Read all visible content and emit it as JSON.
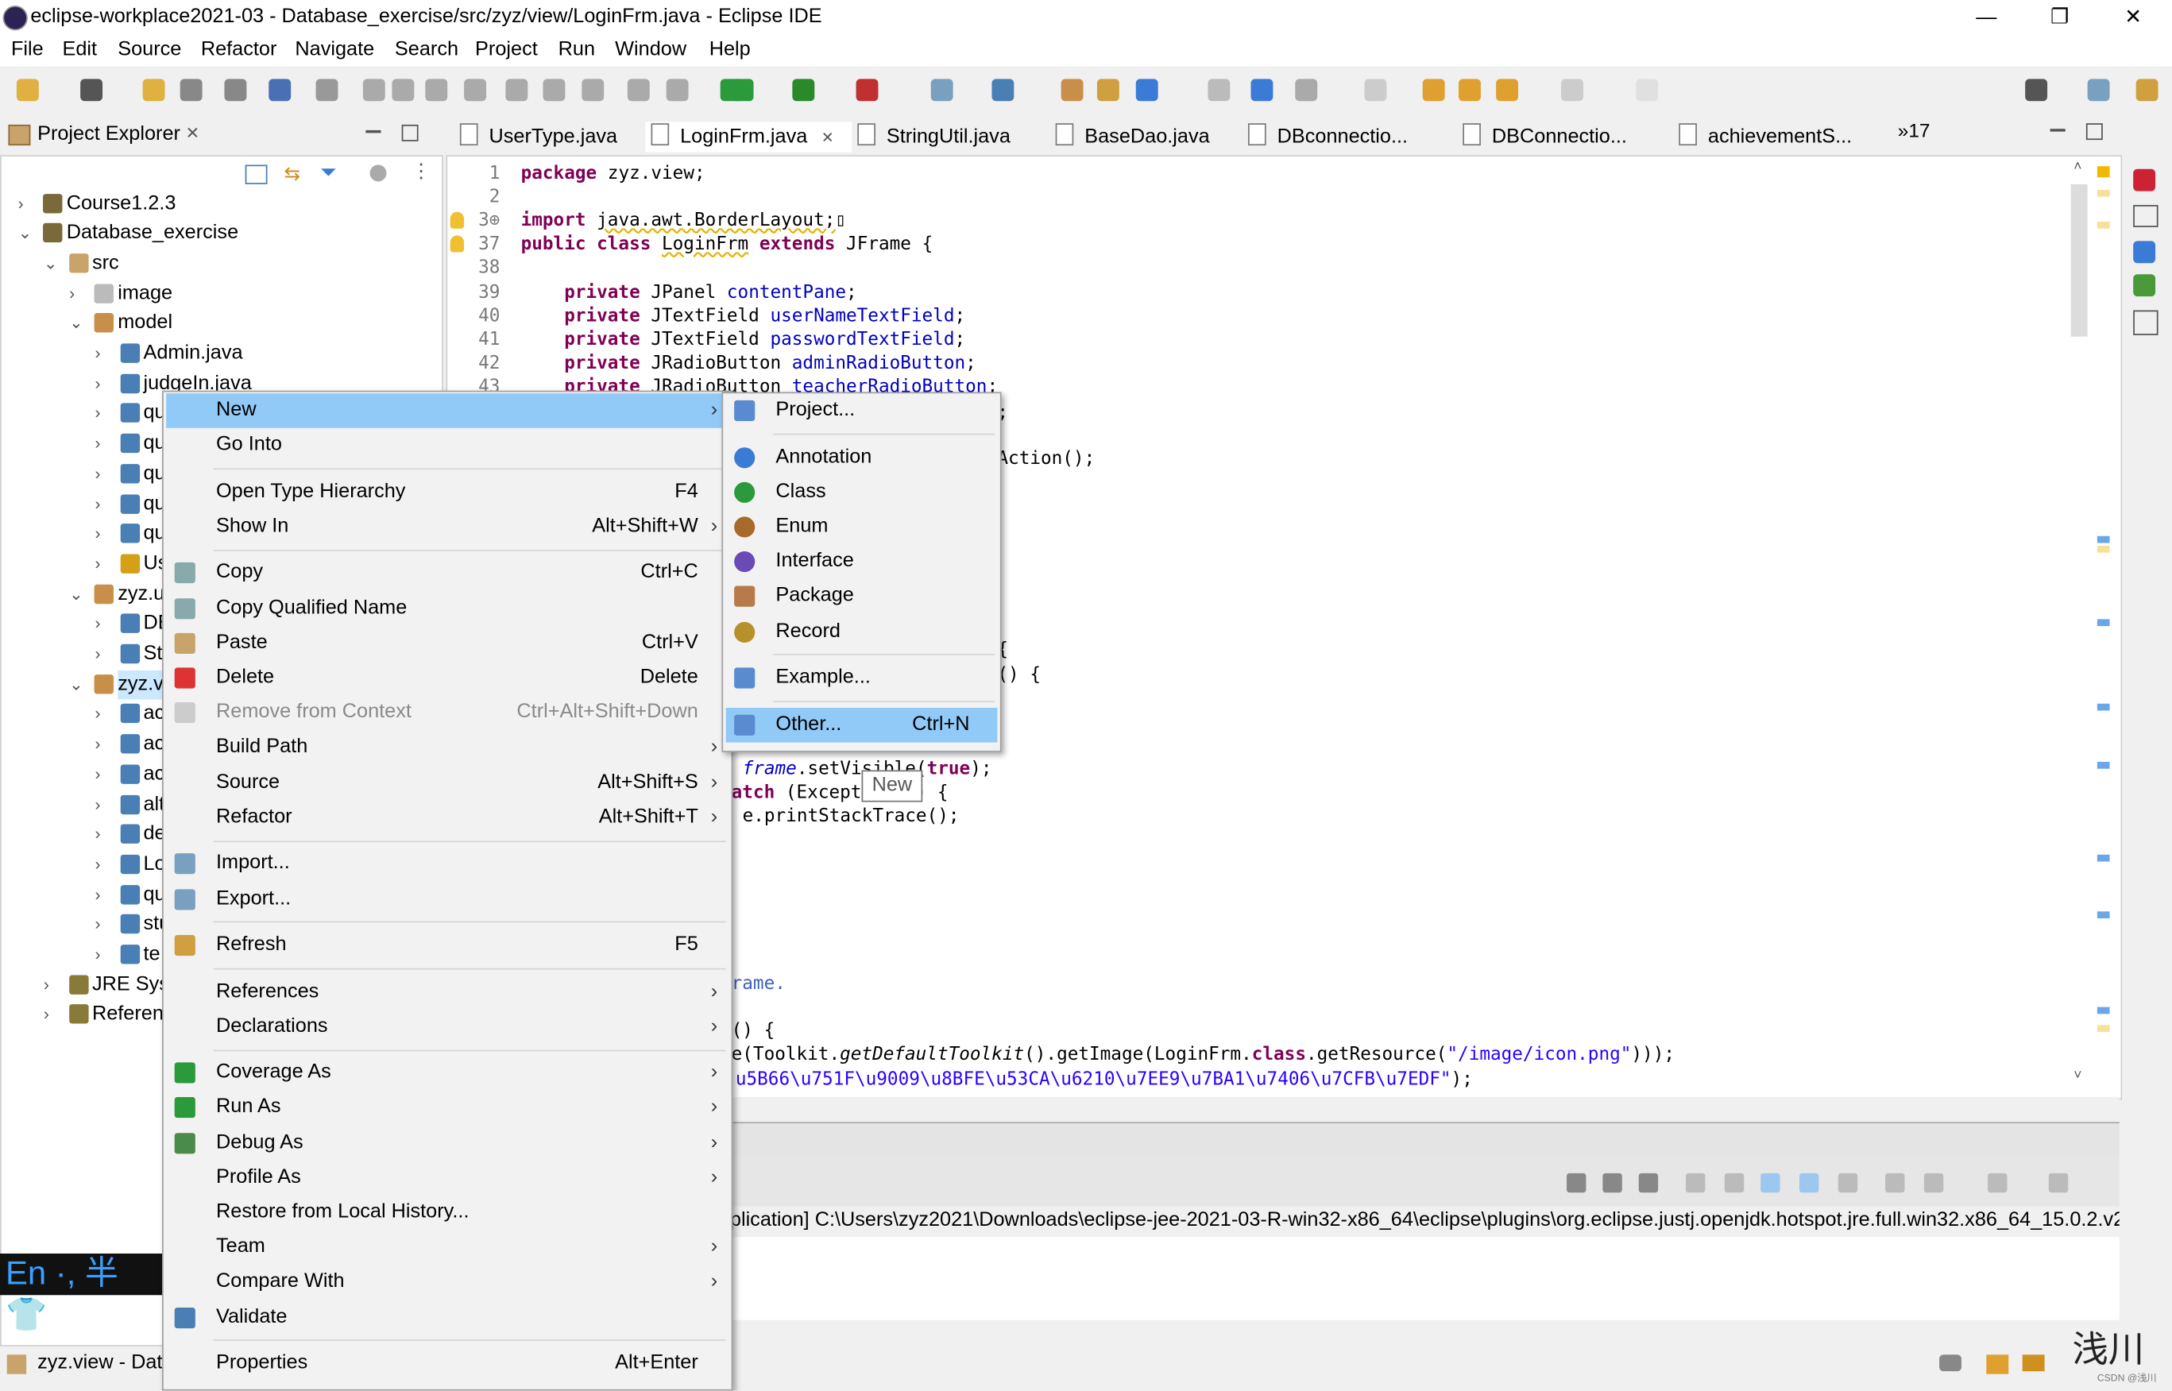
{
  "window": {
    "title": "eclipse-workplace2021-03 - Database_exercise/src/zyz/view/LoginFrm.java - Eclipse IDE",
    "minimize": "—",
    "restore": "❐",
    "close": "✕"
  },
  "menubar": [
    "File",
    "Edit",
    "Source",
    "Refactor",
    "Navigate",
    "Search",
    "Project",
    "Run",
    "Window",
    "Help"
  ],
  "project_explorer": {
    "title": "Project Explorer",
    "close": "✕",
    "tree": [
      {
        "label": "Course1.2.3",
        "level": 0,
        "expanded": false,
        "icon": "project-icon"
      },
      {
        "label": "Database_exercise",
        "level": 0,
        "expanded": true,
        "icon": "project-icon"
      },
      {
        "label": "src",
        "level": 1,
        "expanded": true,
        "icon": "source-folder-icon"
      },
      {
        "label": "image",
        "level": 2,
        "expanded": false,
        "icon": "package-empty-icon"
      },
      {
        "label": "model",
        "level": 2,
        "expanded": true,
        "icon": "package-icon"
      },
      {
        "label": "Admin.java",
        "level": 3,
        "expanded": false,
        "icon": "java-file-icon"
      },
      {
        "label": "judgeIn.java",
        "level": 3,
        "expanded": false,
        "icon": "java-file-icon"
      },
      {
        "label": "qu",
        "level": 3,
        "expanded": false,
        "icon": "java-file-icon"
      },
      {
        "label": "qu",
        "level": 3,
        "expanded": false,
        "icon": "java-file-icon"
      },
      {
        "label": "qu",
        "level": 3,
        "expanded": false,
        "icon": "java-file-icon"
      },
      {
        "label": "qu",
        "level": 3,
        "expanded": false,
        "icon": "java-file-icon"
      },
      {
        "label": "qu",
        "level": 3,
        "expanded": false,
        "icon": "java-file-icon"
      },
      {
        "label": "Us",
        "level": 3,
        "expanded": false,
        "icon": "java-file-warning-icon"
      },
      {
        "label": "zyz.u",
        "level": 2,
        "expanded": true,
        "icon": "package-icon"
      },
      {
        "label": "DE",
        "level": 3,
        "expanded": false,
        "icon": "java-file-icon"
      },
      {
        "label": "St",
        "level": 3,
        "expanded": false,
        "icon": "java-file-icon"
      },
      {
        "label": "zyz.v",
        "level": 2,
        "expanded": true,
        "icon": "package-icon",
        "selected": true
      },
      {
        "label": "ac",
        "level": 3,
        "expanded": false,
        "icon": "java-file-icon"
      },
      {
        "label": "ac",
        "level": 3,
        "expanded": false,
        "icon": "java-file-icon"
      },
      {
        "label": "ac",
        "level": 3,
        "expanded": false,
        "icon": "java-file-icon"
      },
      {
        "label": "alt",
        "level": 3,
        "expanded": false,
        "icon": "java-file-icon"
      },
      {
        "label": "de",
        "level": 3,
        "expanded": false,
        "icon": "java-file-icon"
      },
      {
        "label": "Lo",
        "level": 3,
        "expanded": false,
        "icon": "java-file-icon"
      },
      {
        "label": "qu",
        "level": 3,
        "expanded": false,
        "icon": "java-file-icon"
      },
      {
        "label": "stu",
        "level": 3,
        "expanded": false,
        "icon": "java-file-icon"
      },
      {
        "label": "te",
        "level": 3,
        "expanded": false,
        "icon": "java-file-icon"
      },
      {
        "label": "JRE Syst",
        "level": 1,
        "expanded": false,
        "icon": "library-icon"
      },
      {
        "label": "Referen",
        "level": 1,
        "expanded": false,
        "icon": "library-icon"
      }
    ]
  },
  "editor": {
    "tabs": [
      {
        "label": "UserType.java"
      },
      {
        "label": "LoginFrm.java",
        "active": true,
        "close": "✕"
      },
      {
        "label": "StringUtil.java"
      },
      {
        "label": "BaseDao.java"
      },
      {
        "label": "DBconnectio..."
      },
      {
        "label": "DBConnectio..."
      },
      {
        "label": "achievementS..."
      }
    ],
    "overflow_tabs": "»17",
    "lines": [
      {
        "num": "1",
        "segs": [
          {
            "t": "package",
            "k": "kw"
          },
          {
            "t": " zyz.view;",
            "k": ""
          }
        ]
      },
      {
        "num": "2",
        "segs": []
      },
      {
        "num": "3⊕",
        "segs": [
          {
            "t": "import",
            "k": "kw"
          },
          {
            "t": " ",
            "k": ""
          },
          {
            "t": "java.awt.BorderLayout;",
            "k": "warn"
          },
          {
            "t": "▯",
            "k": ""
          }
        ]
      },
      {
        "num": "37",
        "segs": [
          {
            "t": "public class",
            "k": "kw"
          },
          {
            "t": " ",
            "k": ""
          },
          {
            "t": "LoginFrm",
            "k": "warn"
          },
          {
            "t": " ",
            "k": ""
          },
          {
            "t": "extends",
            "k": "kw"
          },
          {
            "t": " JFrame {",
            "k": ""
          }
        ]
      },
      {
        "num": "38",
        "segs": []
      },
      {
        "num": "39",
        "segs": [
          {
            "t": "    private",
            "k": "kw"
          },
          {
            "t": " JPanel ",
            "k": ""
          },
          {
            "t": "contentPane",
            "k": "fld"
          },
          {
            "t": ";",
            "k": ""
          }
        ]
      },
      {
        "num": "40",
        "segs": [
          {
            "t": "    private",
            "k": "kw"
          },
          {
            "t": " JTextField ",
            "k": ""
          },
          {
            "t": "userNameTextField",
            "k": "fld"
          },
          {
            "t": ";",
            "k": ""
          }
        ]
      },
      {
        "num": "41",
        "segs": [
          {
            "t": "    private",
            "k": "kw"
          },
          {
            "t": " JTextField ",
            "k": ""
          },
          {
            "t": "passwordTextField",
            "k": "fld"
          },
          {
            "t": ";",
            "k": ""
          }
        ]
      },
      {
        "num": "42",
        "segs": [
          {
            "t": "    private",
            "k": "kw"
          },
          {
            "t": " JRadioButton ",
            "k": ""
          },
          {
            "t": "adminRadioButton",
            "k": "fld"
          },
          {
            "t": ";",
            "k": ""
          }
        ]
      },
      {
        "num": "43",
        "segs": [
          {
            "t": "    private",
            "k": "kw"
          },
          {
            "t": " JRadioButton ",
            "k": ""
          },
          {
            "t": "teacherRadioButton",
            "k": "fld"
          },
          {
            "t": ";",
            "k": ""
          }
        ]
      }
    ],
    "fragments": [
      {
        "segs": [
          {
            "t": ";",
            "k": ""
          }
        ]
      },
      {
        "segs": [
          {
            "t": "Action();",
            "k": ""
          }
        ]
      },
      {
        "segs": [
          {
            "t": "{",
            "k": ""
          }
        ]
      },
      {
        "segs": [
          {
            "t": "() {",
            "k": ""
          }
        ]
      },
      {
        "segs": [
          {
            "t": "frame",
            "k": "itfld"
          },
          {
            "t": ".setVisible(",
            "k": ""
          },
          {
            "t": "true",
            "k": "kw"
          },
          {
            "t": ");",
            "k": ""
          }
        ]
      },
      {
        "segs": [
          {
            "t": "atch",
            "k": "kw"
          },
          {
            "t": " (Exception e) {",
            "k": ""
          }
        ]
      },
      {
        "segs": [
          {
            "t": "e.printStackTrace();",
            "k": ""
          }
        ]
      },
      {
        "segs": [
          {
            "t": "rame.",
            "k": "cm"
          }
        ]
      },
      {
        "segs": [
          {
            "t": "() {",
            "k": ""
          }
        ]
      },
      {
        "segs": [
          {
            "t": "e(Toolkit.",
            "k": ""
          },
          {
            "t": "getDefaultToolkit",
            "k": "ital"
          },
          {
            "t": "().getImage(LoginFrm.",
            "k": ""
          },
          {
            "t": "class",
            "k": "kw"
          },
          {
            "t": ".getResource(",
            "k": ""
          },
          {
            "t": "\"/image/icon.png\"",
            "k": "str"
          },
          {
            "t": ")));",
            "k": ""
          }
        ]
      },
      {
        "segs": [
          {
            "t": "u5B66\\u751F\\u9009\\u8BFE\\u53CA\\u6210\\u7EE9\\u7BA1\\u7406\\u7CFB\\u7EDF\"",
            "k": "str"
          },
          {
            "t": ");",
            "k": ""
          }
        ]
      }
    ]
  },
  "context_menu": {
    "items": [
      {
        "label": "New",
        "submenu": true,
        "highlight": true
      },
      {
        "label": "Go Into",
        "sep_after": true
      },
      {
        "label": "Open Type Hierarchy",
        "shortcut": "F4"
      },
      {
        "label": "Show In",
        "shortcut": "Alt+Shift+W",
        "submenu": true,
        "sep_after": true
      },
      {
        "label": "Copy",
        "shortcut": "Ctrl+C",
        "icon": "copy-icon"
      },
      {
        "label": "Copy Qualified Name",
        "icon": "copy-qualified-icon"
      },
      {
        "label": "Paste",
        "shortcut": "Ctrl+V",
        "icon": "paste-icon"
      },
      {
        "label": "Delete",
        "shortcut": "Delete",
        "icon": "delete-icon"
      },
      {
        "label": "Remove from Context",
        "shortcut": "Ctrl+Alt+Shift+Down",
        "icon": "remove-context-icon",
        "disabled": true
      },
      {
        "label": "Build Path",
        "submenu": true
      },
      {
        "label": "Source",
        "shortcut": "Alt+Shift+S",
        "submenu": true
      },
      {
        "label": "Refactor",
        "shortcut": "Alt+Shift+T",
        "submenu": true,
        "sep_after": true
      },
      {
        "label": "Import...",
        "icon": "import-icon"
      },
      {
        "label": "Export...",
        "icon": "export-icon",
        "sep_after": true
      },
      {
        "label": "Refresh",
        "shortcut": "F5",
        "icon": "refresh-icon",
        "sep_after": true
      },
      {
        "label": "References",
        "submenu": true
      },
      {
        "label": "Declarations",
        "submenu": true,
        "sep_after": true
      },
      {
        "label": "Coverage As",
        "submenu": true,
        "icon": "coverage-icon"
      },
      {
        "label": "Run As",
        "submenu": true,
        "icon": "run-icon"
      },
      {
        "label": "Debug As",
        "submenu": true,
        "icon": "debug-icon"
      },
      {
        "label": "Profile As",
        "submenu": true
      },
      {
        "label": "Restore from Local History..."
      },
      {
        "label": "Team",
        "submenu": true
      },
      {
        "label": "Compare With",
        "submenu": true
      },
      {
        "label": "Validate",
        "icon": "checkbox-checked-icon",
        "sep_after": true
      },
      {
        "label": "Properties",
        "shortcut": "Alt+Enter"
      }
    ],
    "submenu_arrow": "›"
  },
  "new_submenu": {
    "items": [
      {
        "label": "Project...",
        "icon": "new-project-icon",
        "sep_after": true
      },
      {
        "label": "Annotation",
        "icon": "new-annotation-icon"
      },
      {
        "label": "Class",
        "icon": "new-class-icon"
      },
      {
        "label": "Enum",
        "icon": "new-enum-icon"
      },
      {
        "label": "Interface",
        "icon": "new-interface-icon"
      },
      {
        "label": "Package",
        "icon": "new-package-icon"
      },
      {
        "label": "Record",
        "icon": "new-record-icon",
        "sep_after": true
      },
      {
        "label": "Example...",
        "icon": "new-example-icon",
        "sep_after": true
      },
      {
        "label": "Other...",
        "shortcut": "Ctrl+N",
        "icon": "new-other-icon",
        "highlight": true
      }
    ]
  },
  "tooltip": "New",
  "console": {
    "path": "plication] C:\\Users\\zyz2021\\Downloads\\eclipse-jee-2021-03-R-win32-x86_64\\eclipse\\plugins\\org.eclipse.justj.openjdk.hotspot.jre.full.win32.x86_64_15.0.2.v202"
  },
  "ime": {
    "text": "En ·, 半 👕"
  },
  "status": {
    "selection": "zyz.view - Dat"
  },
  "watermark": {
    "text": "浅川",
    "sub": "CSDN @浅川"
  },
  "colors": {
    "highlight": "#91c9f7",
    "keyword": "#7f0055",
    "field": "#0000c0",
    "string": "#2a00ff"
  }
}
